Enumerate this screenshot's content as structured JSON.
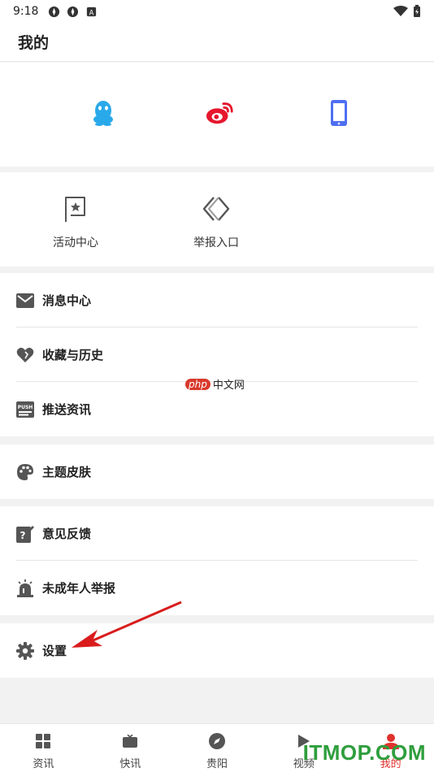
{
  "status_bar": {
    "time": "9:18",
    "icons": [
      "app-notification-icon",
      "app-notification-icon",
      "font-notification-icon"
    ],
    "right_icons": [
      "wifi-icon",
      "battery-icon"
    ]
  },
  "header": {
    "title": "我的"
  },
  "login": {
    "items": [
      {
        "icon": "qq-icon",
        "color": "#29a9ea"
      },
      {
        "icon": "weibo-icon",
        "color": "#e6162d"
      },
      {
        "icon": "phone-icon",
        "color": "#4e6ef2"
      }
    ]
  },
  "quick_actions": [
    {
      "label": "活动中心",
      "icon": "activity-flag-icon"
    },
    {
      "label": "举报入口",
      "icon": "report-icon"
    }
  ],
  "menu_groups": [
    {
      "items": [
        {
          "label": "消息中心",
          "icon": "envelope-icon"
        },
        {
          "label": "收藏与历史",
          "icon": "heart-icon"
        },
        {
          "label": "推送资讯",
          "icon": "push-icon"
        }
      ]
    },
    {
      "items": [
        {
          "label": "主题皮肤",
          "icon": "palette-icon"
        }
      ]
    },
    {
      "items": [
        {
          "label": "意见反馈",
          "icon": "feedback-icon"
        },
        {
          "label": "未成年人举报",
          "icon": "alarm-icon"
        }
      ]
    },
    {
      "items": [
        {
          "label": "设置",
          "icon": "gear-icon"
        }
      ]
    }
  ],
  "watermark": {
    "php": "php",
    "site": "中文网"
  },
  "tabbar": {
    "tabs": [
      {
        "label": "资讯",
        "icon": "grid-icon",
        "active": false
      },
      {
        "label": "快讯",
        "icon": "tv-icon",
        "active": false
      },
      {
        "label": "贵阳",
        "icon": "compass-icon",
        "active": false
      },
      {
        "label": "视频",
        "icon": "play-icon",
        "active": false
      },
      {
        "label": "我的",
        "icon": "user-icon",
        "active": true
      }
    ]
  },
  "brand_watermark": "ITMOP.COM",
  "colors": {
    "active": "#e0322d",
    "icon_gray": "#555555",
    "annotation_arrow": "#d91c1c"
  }
}
